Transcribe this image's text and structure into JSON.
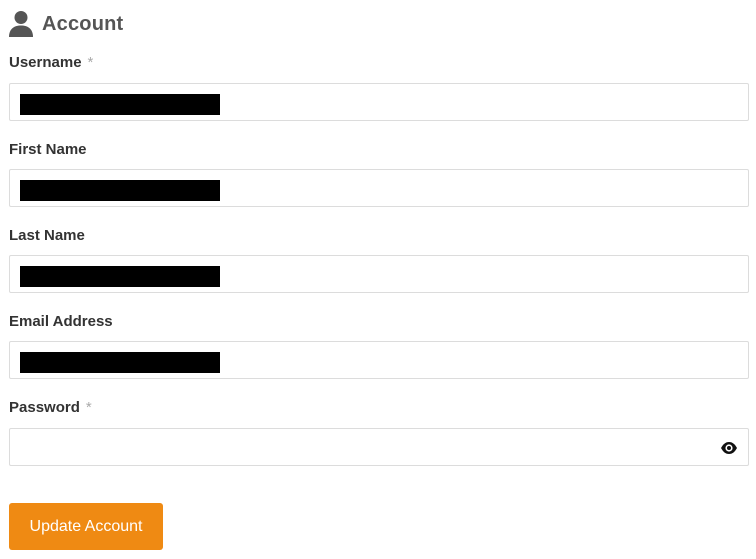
{
  "section": {
    "title": "Account",
    "icon": "user-icon"
  },
  "fields": {
    "username": {
      "label": "Username",
      "required_mark": "*",
      "value": ""
    },
    "first_name": {
      "label": "First Name",
      "value": ""
    },
    "last_name": {
      "label": "Last Name",
      "value": ""
    },
    "email": {
      "label": "Email Address",
      "value": ""
    },
    "password": {
      "label": "Password",
      "required_mark": "*",
      "value": "",
      "toggle_icon": "eye-icon"
    }
  },
  "submit": {
    "label": "Update Account"
  },
  "colors": {
    "accent": "#ef8a13",
    "label": "#333333",
    "required": "#aaaaaa",
    "input_border": "#dcdcdc",
    "redaction": "#000000"
  }
}
